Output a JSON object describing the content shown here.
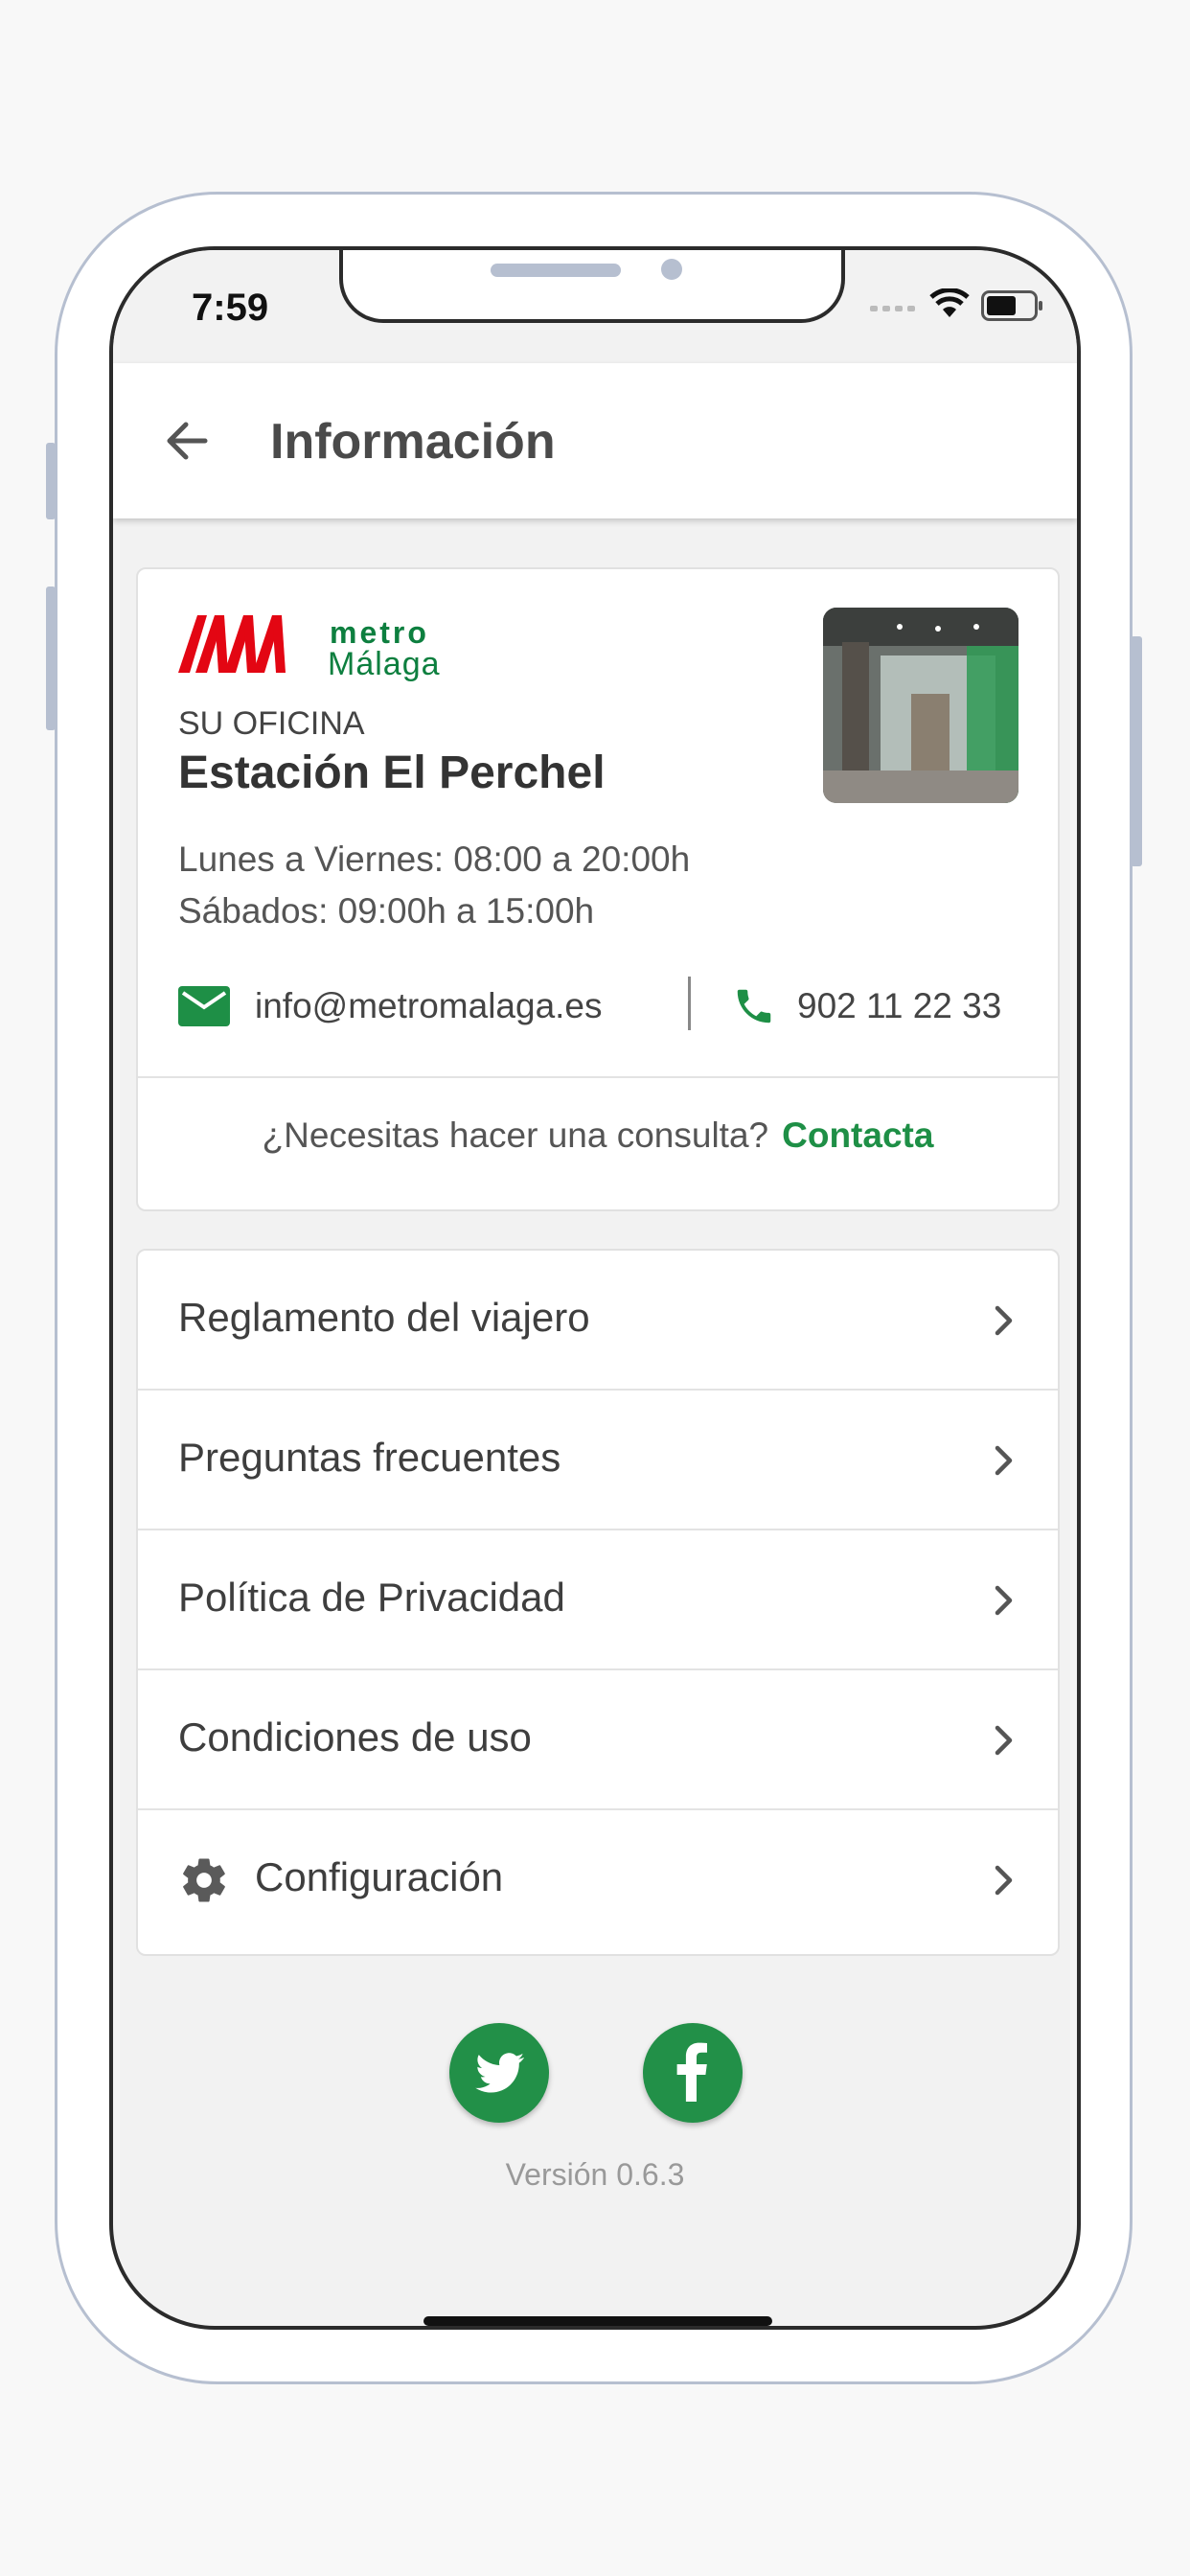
{
  "status_bar": {
    "time": "7:59"
  },
  "header": {
    "title": "Información"
  },
  "office": {
    "brand_line1": "metro",
    "brand_line2": "Málaga",
    "label": "SU OFICINA",
    "station": "Estación El Perchel",
    "hours": [
      "Lunes a Viernes: 08:00 a 20:00h",
      "Sábados: 09:00h a 15:00h"
    ],
    "email": "info@metromalaga.es",
    "phone": "902 11 22 33",
    "consult_question": "¿Necesitas hacer una consulta?",
    "consult_link": "Contacta"
  },
  "menu": [
    {
      "label": "Reglamento del viajero"
    },
    {
      "label": "Preguntas frecuentes"
    },
    {
      "label": "Política de Privacidad"
    },
    {
      "label": "Condiciones de uso"
    },
    {
      "label": "Configuración",
      "icon": "gear-icon"
    }
  ],
  "footer": {
    "social": [
      "twitter-icon",
      "facebook-icon"
    ],
    "version": "Versión 0.6.3"
  },
  "colors": {
    "accent": "#1e8f46",
    "brand_red": "#e30613",
    "brand_green": "#0d7f3f"
  }
}
